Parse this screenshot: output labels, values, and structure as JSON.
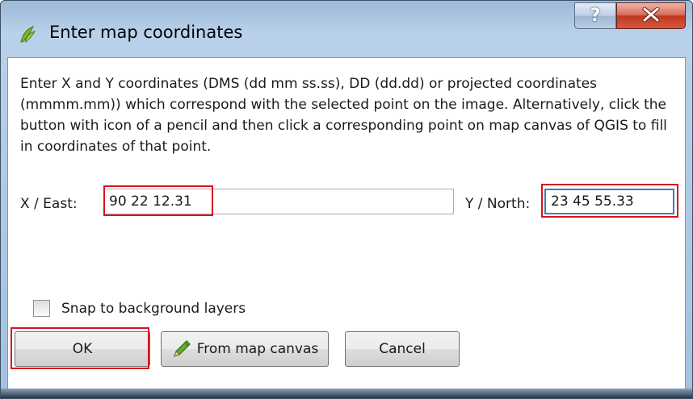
{
  "window": {
    "title": "Enter map coordinates",
    "help_label": "?",
    "close_label": "X"
  },
  "description": "Enter X and Y coordinates (DMS (dd mm ss.ss), DD (dd.dd) or projected coordinates (mmmm.mm)) which correspond with the selected point on the image. Alternatively, click the button with icon of a pencil and then click a corresponding point on map canvas of QGIS to fill in coordinates of that point.",
  "x_east": {
    "label": "X / East:",
    "value": "90 22 12.31"
  },
  "y_north": {
    "label": "Y / North:",
    "value": "23 45 55.33"
  },
  "snap": {
    "label": "Snap to background layers",
    "checked": false
  },
  "buttons": {
    "ok": "OK",
    "from_map_canvas": "From map canvas",
    "cancel": "Cancel"
  },
  "icons": {
    "app": "qgis-icon",
    "pencil": "pencil-icon"
  },
  "colors": {
    "highlight": "#d9121e",
    "close_red": "#c1371f",
    "focus_blue": "#3c7fb1"
  }
}
